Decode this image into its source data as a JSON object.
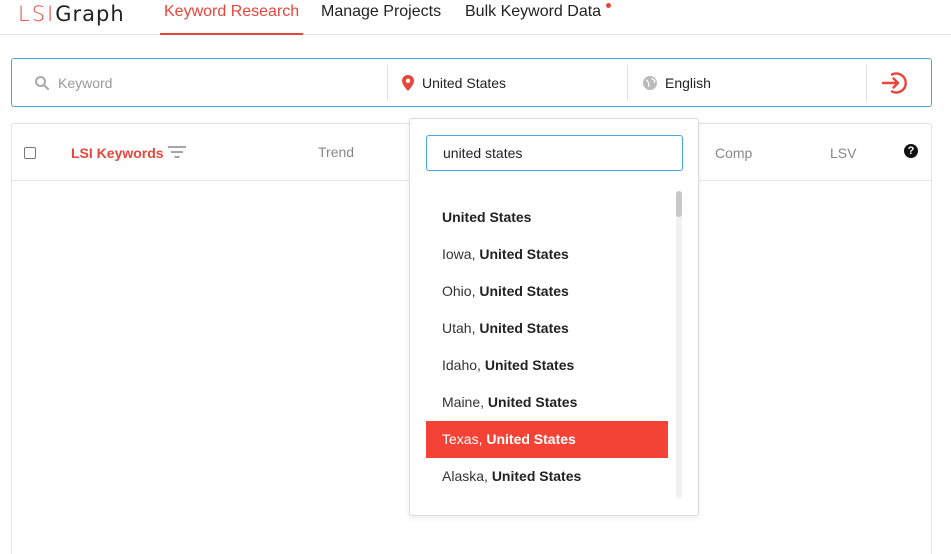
{
  "logo": {
    "part1": "LSI",
    "part2": "Graph"
  },
  "nav": {
    "tabs": [
      {
        "label": "Keyword Research",
        "active": true
      },
      {
        "label": "Manage Projects",
        "active": false
      },
      {
        "label": "Bulk Keyword Data",
        "active": false,
        "notification": true
      }
    ]
  },
  "search": {
    "keyword_placeholder": "Keyword",
    "keyword_value": "",
    "location": "United States",
    "language": "English",
    "icons": {
      "keyword": "search-icon",
      "location": "map-pin-icon",
      "language": "globe-icon",
      "submit": "sign-in-icon"
    }
  },
  "table": {
    "columns": {
      "lsi": "LSI Keywords",
      "trend": "Trend",
      "comp": "Comp",
      "lsv": "LSV",
      "help": "?"
    }
  },
  "location_dropdown": {
    "query": "united states",
    "options": [
      {
        "prefix": "",
        "bold": "United States"
      },
      {
        "prefix": "Iowa, ",
        "bold": "United States"
      },
      {
        "prefix": "Ohio, ",
        "bold": "United States"
      },
      {
        "prefix": "Utah, ",
        "bold": "United States"
      },
      {
        "prefix": "Idaho, ",
        "bold": "United States"
      },
      {
        "prefix": "Maine, ",
        "bold": "United States"
      },
      {
        "prefix": "Texas, ",
        "bold": "United States"
      },
      {
        "prefix": "Alaska, ",
        "bold": "United States"
      }
    ],
    "highlighted_index": 6
  },
  "colors": {
    "accent": "#e8453c",
    "focus_border": "#4aa8e0",
    "highlight": "#f44336"
  }
}
